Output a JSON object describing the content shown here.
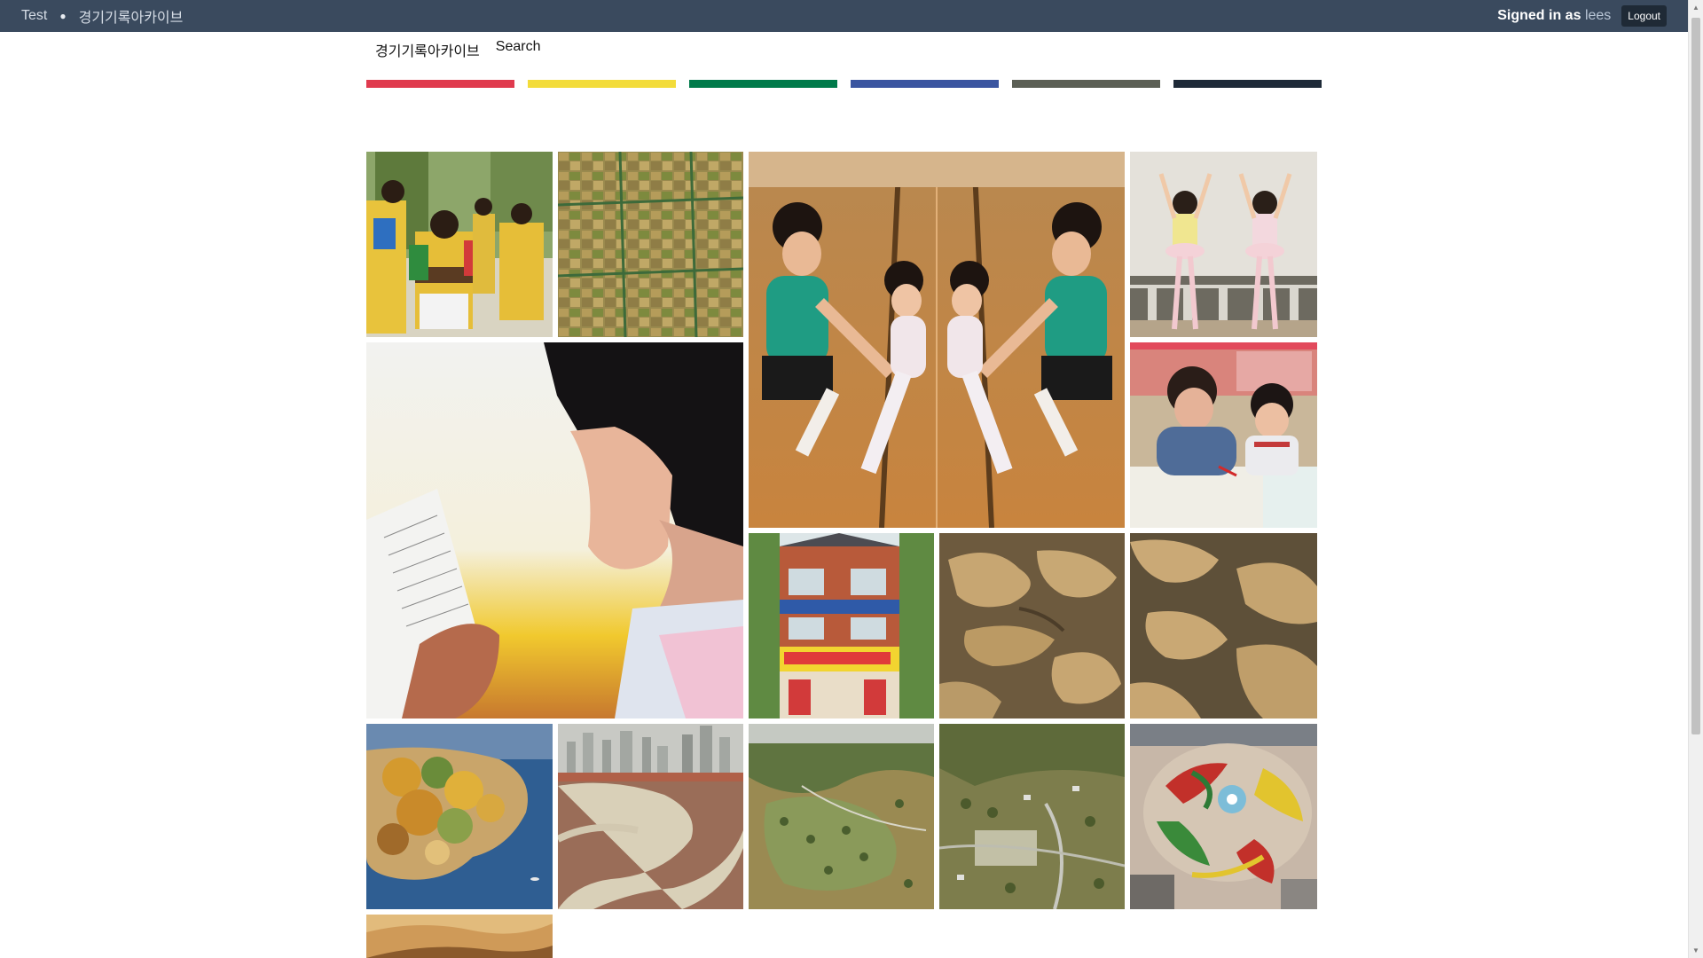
{
  "topbar": {
    "site_link": "Test",
    "separator": "●",
    "archive_link": "경기기록아카이브",
    "signed_in_prefix": "Signed in as",
    "username": "lees",
    "logout_label": "Logout"
  },
  "nav": {
    "home_label": "경기기록아카이브",
    "search_label": "Search"
  },
  "stripes": {
    "colors": [
      "#e03a4e",
      "#f3dc3a",
      "#007a4a",
      "#3a55a0",
      "#5b5f55",
      "#1e2a38"
    ]
  },
  "photos": [
    {
      "icon": "children-dance-photo-icon"
    },
    {
      "icon": "farmland-aerial-photo-icon"
    },
    {
      "icon": "ballet-class-mirror-photo-icon"
    },
    {
      "icon": "ballet-girls-photo-icon"
    },
    {
      "icon": "girl-reading-photo-icon"
    },
    {
      "icon": "teacher-student-photo-icon"
    },
    {
      "icon": "shop-building-photo-icon"
    },
    {
      "icon": "mudflat-aerial-photo-icon"
    },
    {
      "icon": "mudflat-aerial-2-photo-icon"
    },
    {
      "icon": "autumn-island-photo-icon"
    },
    {
      "icon": "tidal-flat-city-photo-icon"
    },
    {
      "icon": "hill-aerial-photo-icon"
    },
    {
      "icon": "village-aerial-photo-icon"
    },
    {
      "icon": "flower-garden-aerial-photo-icon"
    },
    {
      "icon": "desert-dunes-photo-icon"
    }
  ]
}
